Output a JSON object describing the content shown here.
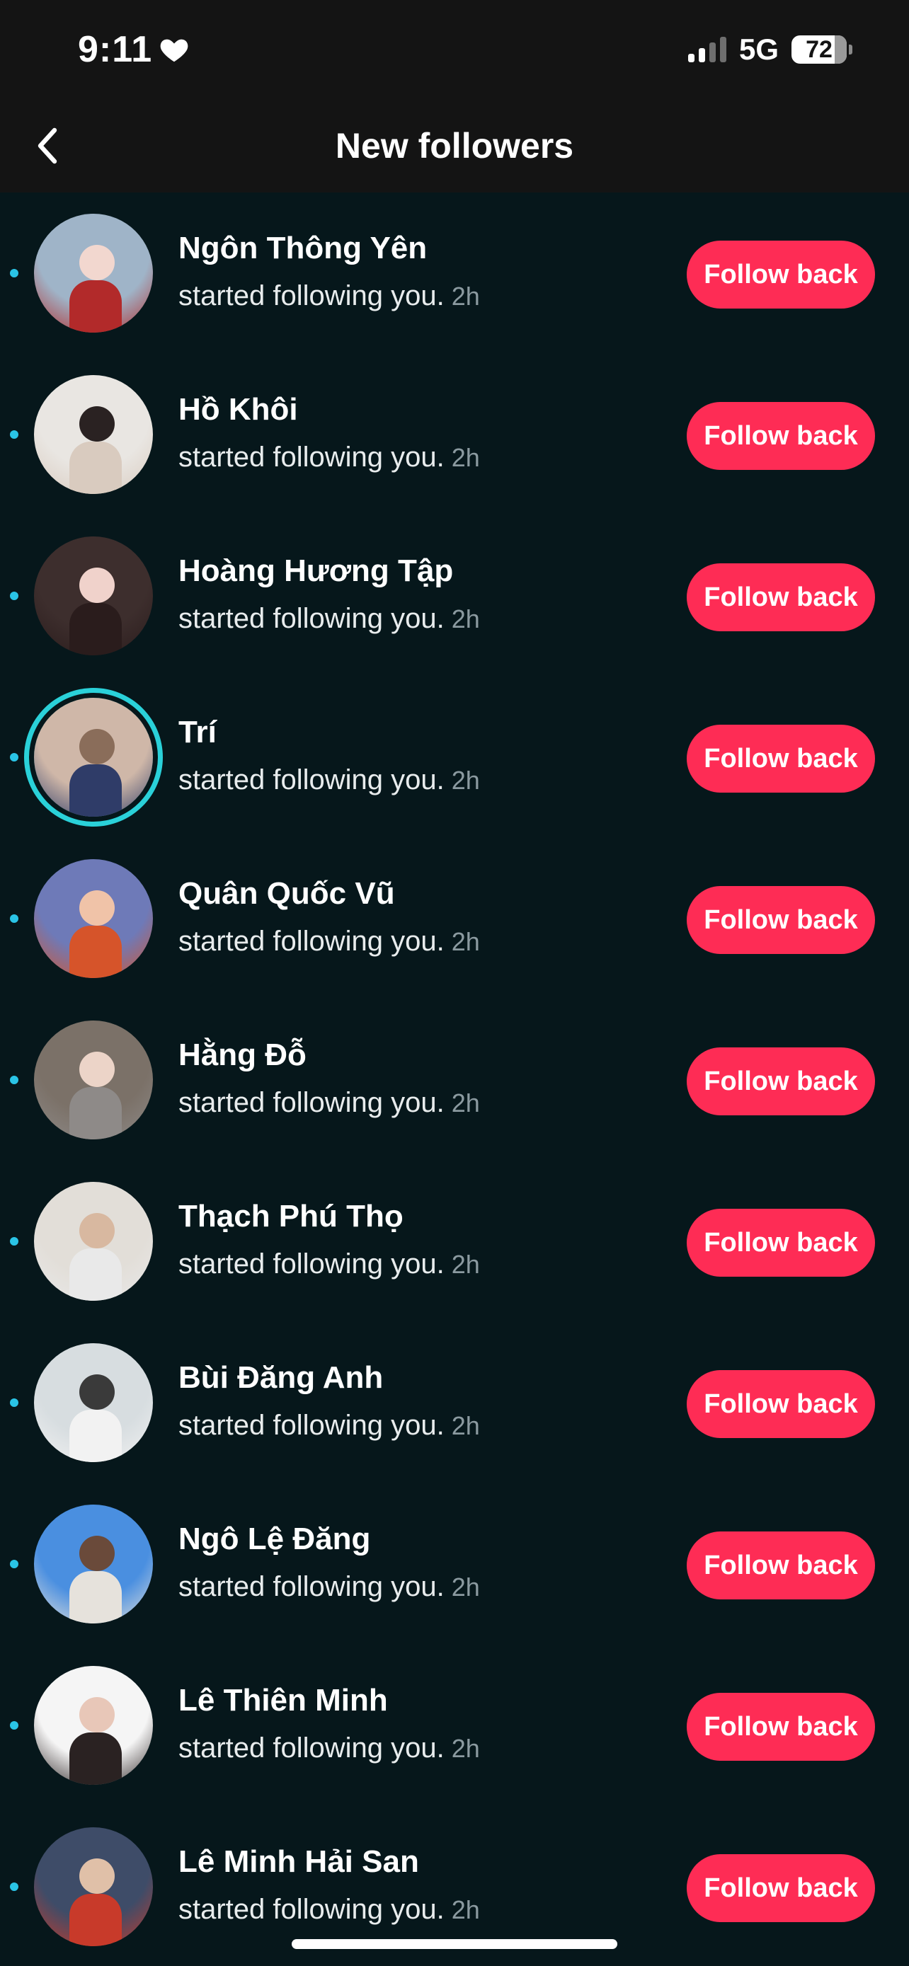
{
  "status_bar": {
    "time": "9:11",
    "network": "5G",
    "battery": "72",
    "battery_level_percent": 72
  },
  "header": {
    "title": "New followers",
    "back_icon": "chevron-left-icon"
  },
  "colors": {
    "background": "#06171b",
    "top_bar": "#141414",
    "accent_button": "#fe2c55",
    "unread_dot": "#2ac4e6",
    "story_ring": "#2ad1d9"
  },
  "followers": [
    {
      "name": "Ngôn Thông Yên",
      "subtitle": "started following you.",
      "time": "2h",
      "button": "Follow back",
      "story": false,
      "avatar_colors": [
        "#9fb4c8",
        "#f2d7cf",
        "#b22a2a"
      ]
    },
    {
      "name": "Hồ Khôi",
      "subtitle": "started following you.",
      "time": "2h",
      "button": "Follow back",
      "story": false,
      "avatar_colors": [
        "#e9e6e2",
        "#2a2222",
        "#d9cbbf"
      ]
    },
    {
      "name": "Hoàng Hương Tập",
      "subtitle": "started following you.",
      "time": "2h",
      "button": "Follow back",
      "story": false,
      "avatar_colors": [
        "#3d2e2d",
        "#f0d2cb",
        "#2a1c1c"
      ]
    },
    {
      "name": "Trí",
      "subtitle": "started following you.",
      "time": "2h",
      "button": "Follow back",
      "story": true,
      "avatar_colors": [
        "#cfb7a8",
        "#8a6d5a",
        "#2f3c68"
      ]
    },
    {
      "name": "Quân Quốc Vũ",
      "subtitle": "started following you.",
      "time": "2h",
      "button": "Follow back",
      "story": false,
      "avatar_colors": [
        "#6e7ab8",
        "#f0c3a8",
        "#d6542a"
      ]
    },
    {
      "name": "Hằng Đỗ",
      "subtitle": "started following you.",
      "time": "2h",
      "button": "Follow back",
      "story": false,
      "avatar_colors": [
        "#7b7168",
        "#ecd4c8",
        "#8e8a88"
      ]
    },
    {
      "name": "Thạch Phú Thọ",
      "subtitle": "started following you.",
      "time": "2h",
      "button": "Follow back",
      "story": false,
      "avatar_colors": [
        "#e2ded8",
        "#d8b8a0",
        "#e9e9e9"
      ]
    },
    {
      "name": "Bùi Đăng Anh",
      "subtitle": "started following you.",
      "time": "2h",
      "button": "Follow back",
      "story": false,
      "avatar_colors": [
        "#d7dde0",
        "#3a3a3a",
        "#f2f2f2"
      ]
    },
    {
      "name": "Ngô Lệ Đăng",
      "subtitle": "started following you.",
      "time": "2h",
      "button": "Follow back",
      "story": false,
      "avatar_colors": [
        "#4a8fe0",
        "#6a4a3a",
        "#e6e2dc"
      ]
    },
    {
      "name": "Lê Thiên Minh",
      "subtitle": "started following you.",
      "time": "2h",
      "button": "Follow back",
      "story": false,
      "avatar_colors": [
        "#f5f5f5",
        "#e8c7b8",
        "#2a2222"
      ]
    },
    {
      "name": "Lê Minh Hải San",
      "subtitle": "started following you.",
      "time": "2h",
      "button": "Follow back",
      "story": false,
      "avatar_colors": [
        "#3e4c68",
        "#e0c0a8",
        "#c83a2a"
      ]
    }
  ]
}
